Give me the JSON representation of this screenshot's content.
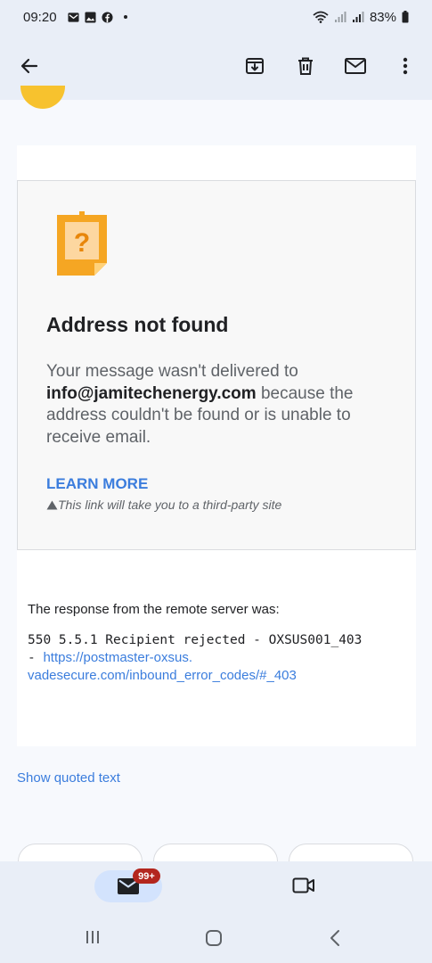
{
  "status_bar": {
    "time": "09:20",
    "battery": "83%",
    "icons": [
      "mail-icon",
      "gallery-icon",
      "facebook-icon",
      "wifi-icon",
      "signal-icon",
      "battery-icon"
    ]
  },
  "toolbar": {
    "icons": [
      "back-arrow-icon",
      "archive-icon",
      "delete-icon",
      "mark-unread-icon",
      "more-icon"
    ]
  },
  "bounce": {
    "title": "Address not found",
    "msg_prefix": "Your message wasn't delivered to ",
    "email": "info@jamitechenergy.com",
    "msg_suffix": " because the address couldn't be found or is unable to receive email.",
    "learn_more": "LEARN MORE",
    "note": "This link will take you to a third-party site"
  },
  "response": {
    "label": "The response from the remote server was:",
    "code_line": "550 5.5.1 Recipient rejected - OXSUS001_403",
    "dash": "- ",
    "link_part1": "https://postmaster-oxsus.",
    "link_part2": "vadesecure.com/inbound_error_codes/#_403"
  },
  "show_quoted": "Show quoted text",
  "bottom_nav": {
    "mail_badge": "99+"
  },
  "colors": {
    "accent": "#3b7ddd",
    "badge": "#b3261e",
    "avatar": "#f7c22e",
    "warning": "#f5a623"
  }
}
